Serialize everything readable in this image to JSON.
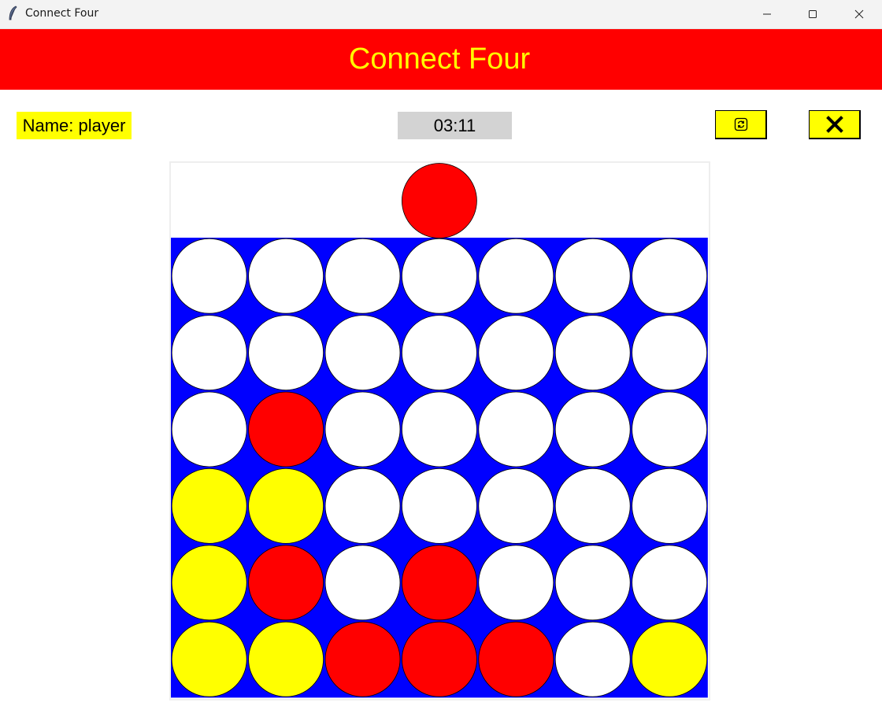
{
  "window": {
    "title": "Connect Four",
    "controls": [
      "minimize-icon",
      "maximize-icon",
      "close-icon"
    ]
  },
  "header": {
    "title": "Connect Four"
  },
  "toolbar": {
    "name_label": "Name: player",
    "timer": "03:11",
    "restart_icon": "restart-icon",
    "quit_icon": "x-icon"
  },
  "colors": {
    "banner": "#ff0000",
    "banner_text": "#ffff00",
    "board": "#0000ff",
    "empty": "#ffffff",
    "red": "#ff0000",
    "yellow": "#ffff00",
    "timer_bg": "#d3d3d3"
  },
  "game": {
    "rows": 6,
    "cols": 7,
    "hover_piece": {
      "column": 3,
      "color": "red"
    },
    "board": [
      [
        "empty",
        "empty",
        "empty",
        "empty",
        "empty",
        "empty",
        "empty"
      ],
      [
        "empty",
        "empty",
        "empty",
        "empty",
        "empty",
        "empty",
        "empty"
      ],
      [
        "empty",
        "red",
        "empty",
        "empty",
        "empty",
        "empty",
        "empty"
      ],
      [
        "yellow",
        "yellow",
        "empty",
        "empty",
        "empty",
        "empty",
        "empty"
      ],
      [
        "yellow",
        "red",
        "empty",
        "red",
        "empty",
        "empty",
        "empty"
      ],
      [
        "yellow",
        "yellow",
        "red",
        "red",
        "red",
        "empty",
        "yellow"
      ]
    ]
  }
}
